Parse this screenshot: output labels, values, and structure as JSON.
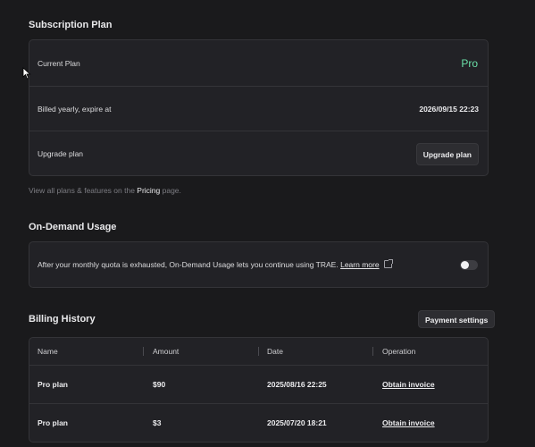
{
  "subscription": {
    "title": "Subscription Plan",
    "current_plan_label": "Current Plan",
    "current_plan_value": "Pro",
    "billing_label": "Billed yearly, expire at",
    "billing_value": "2026/09/15 22:23",
    "upgrade_label": "Upgrade plan",
    "upgrade_button": "Upgrade plan",
    "hint_prefix": "View all plans & features on the ",
    "hint_link": "Pricing",
    "hint_suffix": " page."
  },
  "on_demand": {
    "title": "On-Demand Usage",
    "description": "After your monthly quota is exhausted, On-Demand Usage lets you continue using TRAE.",
    "learn_more": "Learn more",
    "toggle_on": false
  },
  "billing": {
    "title": "Billing History",
    "payment_settings_button": "Payment settings",
    "columns": [
      "Name",
      "Amount",
      "Date",
      "Operation"
    ],
    "rows": [
      {
        "name": "Pro plan",
        "amount": "$90",
        "date": "2025/08/16 22:25",
        "operation": "Obtain invoice"
      },
      {
        "name": "Pro plan",
        "amount": "$3",
        "date": "2025/07/20 18:21",
        "operation": "Obtain invoice"
      }
    ]
  },
  "colors": {
    "background": "#1a1a1c",
    "card": "#222226",
    "accent_pro": "#6be0a8"
  },
  "icons": [
    "cursor-arrow-icon",
    "external-link-icon"
  ]
}
